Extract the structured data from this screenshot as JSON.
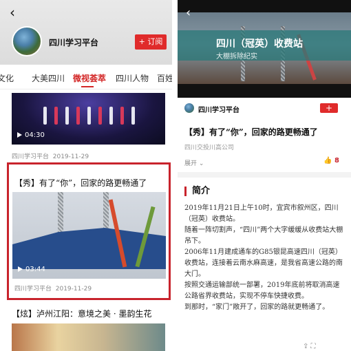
{
  "left": {
    "back_icon": "‹",
    "channel_name": "四川学习平台",
    "subscribe_label": "+ 订阅",
    "tabs": [
      {
        "label": "川文化"
      },
      {
        "label": "大美四川"
      },
      {
        "label": "微视荟萃"
      },
      {
        "label": "四川人物"
      },
      {
        "label": "百姓故事"
      }
    ],
    "active_tab": "微视荟萃",
    "item1": {
      "duration": "04:30",
      "source": "四川学习平台",
      "date": "2019-11-29"
    },
    "item2": {
      "title": "【秀】有了“你”，回家的路更畅通了",
      "duration": "03:44",
      "source": "四川学习平台",
      "date": "2019-11-29"
    },
    "item3": {
      "title": "【炫】泸州江阳：意境之美 · 墨韵生花"
    }
  },
  "right": {
    "back_icon": "‹",
    "video_title": "四川（冠英）收费站",
    "video_subtitle": "大棚拆除纪实",
    "channel_name": "四川学习平台",
    "follow_label": "+",
    "article_title": "【秀】有了“你”，回家的路更畅通了",
    "source_line": "四川交投川高公司",
    "expand_label": "展开",
    "like_count": "8",
    "section_title": "简介",
    "body": [
      "2019年11月21日上午10时，宜宾市叙州区，四川（冠英）收费站。",
      "随着一阵切割声，“四川”两个大字缓缓从收费站大棚吊下。",
      "2006年11月建成通车的G85银昆高速四川（冠英）收费站，连接着云南水麻高速，是我省高速公路的南大门。",
      "按照交通运输部统一部署，2019年底前将取消高速公路省界收费站，实现不停车快捷收费。",
      "到那时，“家门”敞开了，回家的路就更畅通了。"
    ],
    "footer_icons": "⇪  ⛶"
  }
}
